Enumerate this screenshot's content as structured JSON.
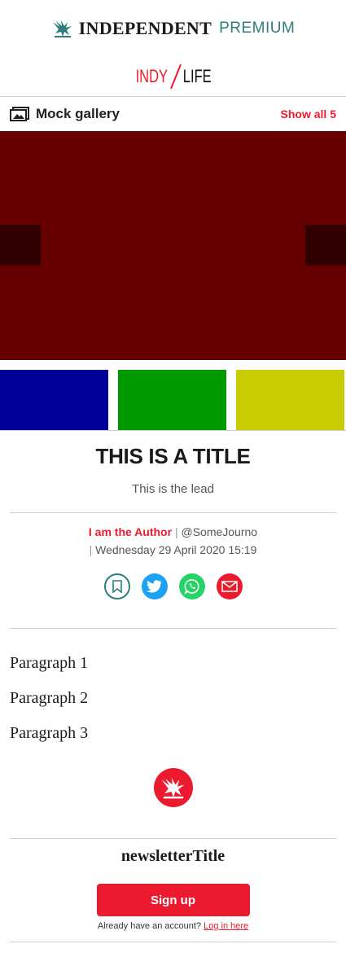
{
  "masthead": {
    "brand": "INDEPENDENT",
    "tier": "PREMIUM"
  },
  "section_brand": {
    "left": "INDY",
    "right": "LIFE"
  },
  "gallery": {
    "title": "Mock gallery",
    "show_all": "Show all 5",
    "main_slide_color": "#660000",
    "thumbnail_colors": [
      "#000099",
      "#009900",
      "#c8cc00"
    ]
  },
  "article": {
    "title": "THIS IS A TITLE",
    "lead": "This is the lead",
    "author": "I am the Author",
    "handle": "@SomeJourno",
    "date": "Wednesday 29 April 2020 15:19",
    "paragraphs": [
      "Paragraph 1",
      "Paragraph 2",
      "Paragraph 3"
    ]
  },
  "share": [
    "bookmark-icon",
    "twitter-icon",
    "whatsapp-icon",
    "email-icon"
  ],
  "newsletter": {
    "title": "newsletterTitle",
    "signup_label": "Sign up",
    "account_prompt": "Already have an account?",
    "login_link": "Log in here"
  },
  "colors": {
    "accent": "#ec1a2e",
    "premium": "#2e7d7d"
  }
}
